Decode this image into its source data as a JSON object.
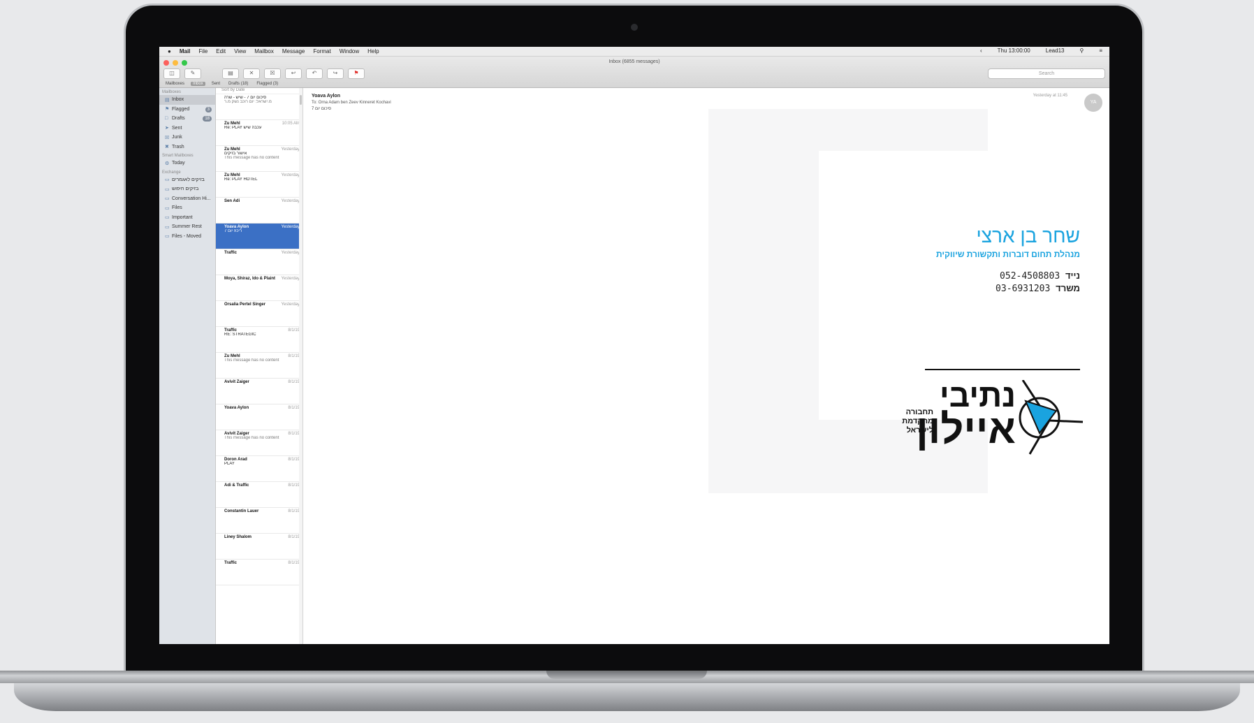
{
  "menubar": {
    "items": [
      "Mail",
      "File",
      "Edit",
      "View",
      "Mailbox",
      "Message",
      "Format",
      "Window",
      "Help"
    ],
    "right": [
      "Thu 13:00:00",
      "Lead13"
    ]
  },
  "window": {
    "title": "Inbox (6855 messages)",
    "search_placeholder": "Search"
  },
  "favorites": [
    "Mailboxes",
    "Inbox",
    "Sent",
    "Drafts (18)",
    "Flagged (3)"
  ],
  "sidebar": {
    "sections": [
      {
        "header": "Mailboxes",
        "items": [
          {
            "label": "Inbox",
            "icon": "inbox-icon",
            "badge": ""
          },
          {
            "label": "Flagged",
            "icon": "flag-icon",
            "badge": "3"
          },
          {
            "label": "Drafts",
            "icon": "document-icon",
            "badge": "18"
          },
          {
            "label": "Sent",
            "icon": "paper-plane-icon",
            "badge": ""
          },
          {
            "label": "Junk",
            "icon": "junk-icon",
            "badge": ""
          },
          {
            "label": "Trash",
            "icon": "trash-icon",
            "badge": ""
          }
        ]
      },
      {
        "header": "Smart Mailboxes",
        "items": [
          {
            "label": "Today",
            "icon": "gear-icon",
            "badge": ""
          }
        ]
      },
      {
        "header": "Exchange",
        "items": [
          {
            "label": "בזיקים לאגמרים",
            "icon": "folder-icon",
            "badge": ""
          },
          {
            "label": "בזיקים חיפוש",
            "icon": "folder-icon",
            "badge": ""
          },
          {
            "label": "Conversation Hi...",
            "icon": "folder-icon",
            "badge": ""
          },
          {
            "label": "Files",
            "icon": "folder-icon",
            "badge": ""
          },
          {
            "label": "Important",
            "icon": "folder-icon",
            "badge": ""
          },
          {
            "label": "Summer Rest",
            "icon": "folder-icon",
            "badge": ""
          },
          {
            "label": "Files - Moved",
            "icon": "folder-icon",
            "badge": ""
          }
        ]
      }
    ]
  },
  "message_list": {
    "sort_label": "Sort by Date",
    "messages": [
      {
        "from": "",
        "date": "",
        "subject": "סיכום יום 7 - שיש - שרה",
        "preview": "מ.ישראל: יום רוכב נשק מ.ר",
        "selected": false
      },
      {
        "from": "Zu Mehl",
        "date": "10:05 AM",
        "subject": "Re: PLAY עכבה שיש",
        "preview": "",
        "selected": false
      },
      {
        "from": "Zu Mehl",
        "date": "Yesterday",
        "subject": "אישור בזיקים",
        "preview": "This message has no content",
        "selected": false
      },
      {
        "from": "Zu Mehl",
        "date": "Yesterday",
        "subject": "Re: PLAY HOTEL",
        "preview": "",
        "selected": false
      },
      {
        "from": "Sen Adi",
        "date": "Yesterday",
        "subject": "",
        "preview": "",
        "selected": false
      },
      {
        "from": "Yoava Aylon",
        "date": "Yesterday",
        "subject": "ריכוז יום 7",
        "preview": "",
        "selected": true
      },
      {
        "from": "Traffic",
        "date": "Yesterday",
        "subject": "",
        "preview": "",
        "selected": false
      },
      {
        "from": "Moya, Shiraz, Ido & Plaint",
        "date": "Yesterday",
        "subject": "",
        "preview": "",
        "selected": false
      },
      {
        "from": "Orsalia Pertel Singer",
        "date": "Yesterday",
        "subject": "",
        "preview": "",
        "selected": false
      },
      {
        "from": "Traffic",
        "date": "8/1/19",
        "subject": "RE: STRATEGIC",
        "preview": "",
        "selected": false
      },
      {
        "from": "Zu Mehl",
        "date": "8/1/19",
        "subject": "",
        "preview": "This message has no content",
        "selected": false
      },
      {
        "from": "Avivit Zaiger",
        "date": "8/1/19",
        "subject": "",
        "preview": "",
        "selected": false
      },
      {
        "from": "Yoava Aylon",
        "date": "8/1/19",
        "subject": "",
        "preview": "",
        "selected": false
      },
      {
        "from": "Avivit Zaiger",
        "date": "8/1/19",
        "subject": "",
        "preview": "This message has no content",
        "selected": false
      },
      {
        "from": "Doron Arad",
        "date": "8/1/19",
        "subject": "PLAY",
        "preview": "",
        "selected": false
      },
      {
        "from": "Adi & Traffic",
        "date": "8/1/19",
        "subject": "",
        "preview": "",
        "selected": false
      },
      {
        "from": "Constantin Lauer",
        "date": "8/1/19",
        "subject": "",
        "preview": "",
        "selected": false
      },
      {
        "from": "Liney Shalom",
        "date": "8/1/19",
        "subject": "",
        "preview": "",
        "selected": false
      },
      {
        "from": "Traffic",
        "date": "8/1/19",
        "subject": "",
        "preview": "",
        "selected": false
      }
    ]
  },
  "message_view": {
    "from": "Yoava Aylon",
    "to": "To: Orna   Adam ben Zeev   Kinneret Kochavi",
    "subject": "סיכום יום 7",
    "date": "Yesterday at 11:45",
    "avatar": "YA"
  },
  "signature": {
    "name": "שחר בן ארצי",
    "title": "מנהלת תחום דוברות ותקשורת שיווקית",
    "mobile_label": "נייד",
    "mobile": "052-4508803",
    "office_label": "משרד",
    "office": "03-6931203",
    "logo_line1": "נתיבי",
    "logo_line2": "איילון",
    "logo_sub": [
      "תחבורה",
      "מתקדמת",
      "לישראל"
    ]
  },
  "colors": {
    "accent": "#1aa3df",
    "selection": "#3b70c5",
    "sidebar_bg": "#dfe3e8"
  }
}
